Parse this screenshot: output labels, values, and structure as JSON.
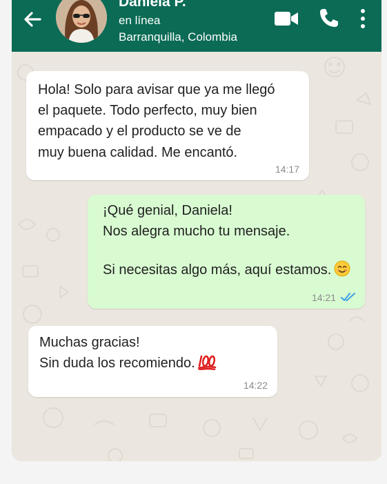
{
  "contact": {
    "name": "Daniela P.",
    "status": "en línea",
    "location": "Barranquilla, Colombia"
  },
  "header_icons": [
    "back-arrow-icon",
    "video-call-icon",
    "phone-icon",
    "more-options-icon"
  ],
  "colors": {
    "header": "#0b6b55",
    "incoming_bubble": "#ffffff",
    "outgoing_bubble": "#d9fbd2",
    "read_ticks": "#3aa0e8",
    "wallpaper": "#ebe6df"
  },
  "messages": [
    {
      "direction": "incoming",
      "lines": [
        "Hola! Solo para avisar que ya me llegó",
        "el paquete. Todo perfecto, muy bien",
        "empacado y el producto se ve de",
        "muy buena calidad. Me encantó."
      ],
      "time": "14:17"
    },
    {
      "direction": "outgoing",
      "lines": [
        "¡Qué genial, Daniela!",
        "Nos alegra mucho tu mensaje.",
        "",
        "Si necesitas algo más, aquí estamos."
      ],
      "emoji": "smiling-face-emoji",
      "time": "14:21",
      "read": true
    },
    {
      "direction": "incoming",
      "lines": [
        "Muchas gracias!",
        "Sin duda los recomiendo."
      ],
      "emoji": "hundred-points-emoji",
      "time": "14:22"
    }
  ]
}
